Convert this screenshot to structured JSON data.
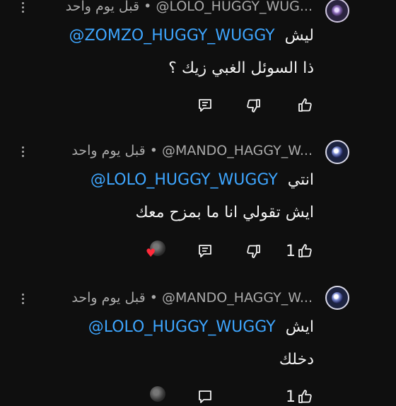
{
  "comments": [
    {
      "author": "@LOLO_HUGGY_WUG...",
      "age": "قبل يوم واحد",
      "separator": "•",
      "line1_prefix": "ليش",
      "line1_mention": "@ZOMZO_HUGGY_WUGGY",
      "line2": "ذا السوئل الغبي زيك ؟",
      "like_count": ""
    },
    {
      "author": "@MANDO_HAGGY_W...",
      "age": "قبل يوم واحد",
      "separator": "•",
      "line1_prefix": "انتي",
      "line1_mention": "@LOLO_HUGGY_WUGGY",
      "line2": "ايش تقولي انا ما بمزح معك",
      "like_count": "1"
    },
    {
      "author": "@MANDO_HAGGY_W...",
      "age": "قبل يوم واحد",
      "separator": "•",
      "line1_prefix": "ايش",
      "line1_mention": "@LOLO_HUGGY_WUGGY",
      "line2": "دخلك",
      "like_count": "1"
    }
  ],
  "colors": {
    "background": "#0f0f0f",
    "mention": "#3ea6ff",
    "meta": "#aaaaaa",
    "heart": "#ff2a3a"
  },
  "icons": [
    "avatar",
    "more-vert-icon",
    "thumb-up-icon",
    "thumb-down-icon",
    "reply-icon",
    "creator-heart-icon"
  ]
}
